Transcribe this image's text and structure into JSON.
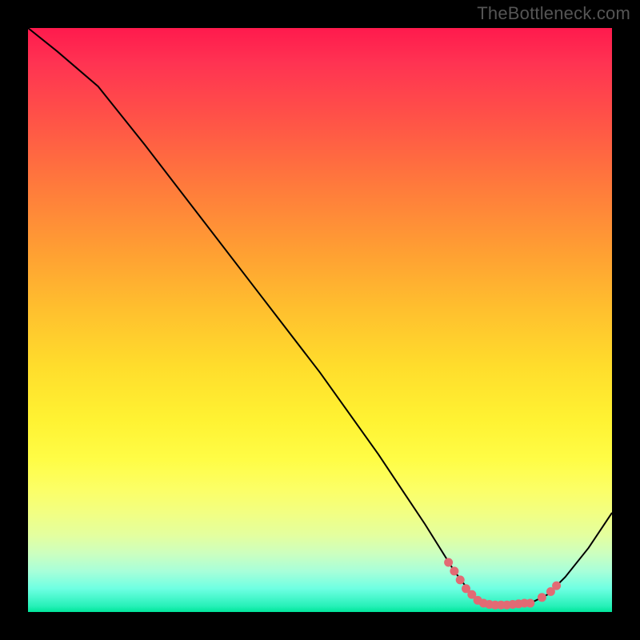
{
  "watermark": "TheBottleneck.com",
  "chart_data": {
    "type": "line",
    "title": "",
    "xlabel": "",
    "ylabel": "",
    "xlim": [
      0,
      100
    ],
    "ylim": [
      0,
      100
    ],
    "curve": [
      {
        "x": 0,
        "y": 100
      },
      {
        "x": 5,
        "y": 96
      },
      {
        "x": 12,
        "y": 90
      },
      {
        "x": 20,
        "y": 80
      },
      {
        "x": 30,
        "y": 67
      },
      {
        "x": 40,
        "y": 54
      },
      {
        "x": 50,
        "y": 41
      },
      {
        "x": 60,
        "y": 27
      },
      {
        "x": 68,
        "y": 15
      },
      {
        "x": 73,
        "y": 7
      },
      {
        "x": 76,
        "y": 3
      },
      {
        "x": 78,
        "y": 1.5
      },
      {
        "x": 82,
        "y": 1.2
      },
      {
        "x": 86,
        "y": 1.5
      },
      {
        "x": 89,
        "y": 3
      },
      {
        "x": 92,
        "y": 6
      },
      {
        "x": 96,
        "y": 11
      },
      {
        "x": 100,
        "y": 17
      }
    ],
    "optimal_zone_points": [
      {
        "x": 72,
        "y": 8.5
      },
      {
        "x": 73,
        "y": 7
      },
      {
        "x": 74,
        "y": 5.5
      },
      {
        "x": 75,
        "y": 4
      },
      {
        "x": 76,
        "y": 3
      },
      {
        "x": 77,
        "y": 2
      },
      {
        "x": 78,
        "y": 1.5
      },
      {
        "x": 79,
        "y": 1.3
      },
      {
        "x": 80,
        "y": 1.2
      },
      {
        "x": 81,
        "y": 1.2
      },
      {
        "x": 82,
        "y": 1.2
      },
      {
        "x": 83,
        "y": 1.3
      },
      {
        "x": 84,
        "y": 1.4
      },
      {
        "x": 85,
        "y": 1.5
      },
      {
        "x": 86,
        "y": 1.5
      },
      {
        "x": 88,
        "y": 2.5
      },
      {
        "x": 89.5,
        "y": 3.5
      },
      {
        "x": 90.5,
        "y": 4.5
      }
    ],
    "colors": {
      "curve": "#000000",
      "dots": "#e26a74",
      "gradient_top": "#ff1a4d",
      "gradient_bottom": "#00e69a"
    }
  }
}
